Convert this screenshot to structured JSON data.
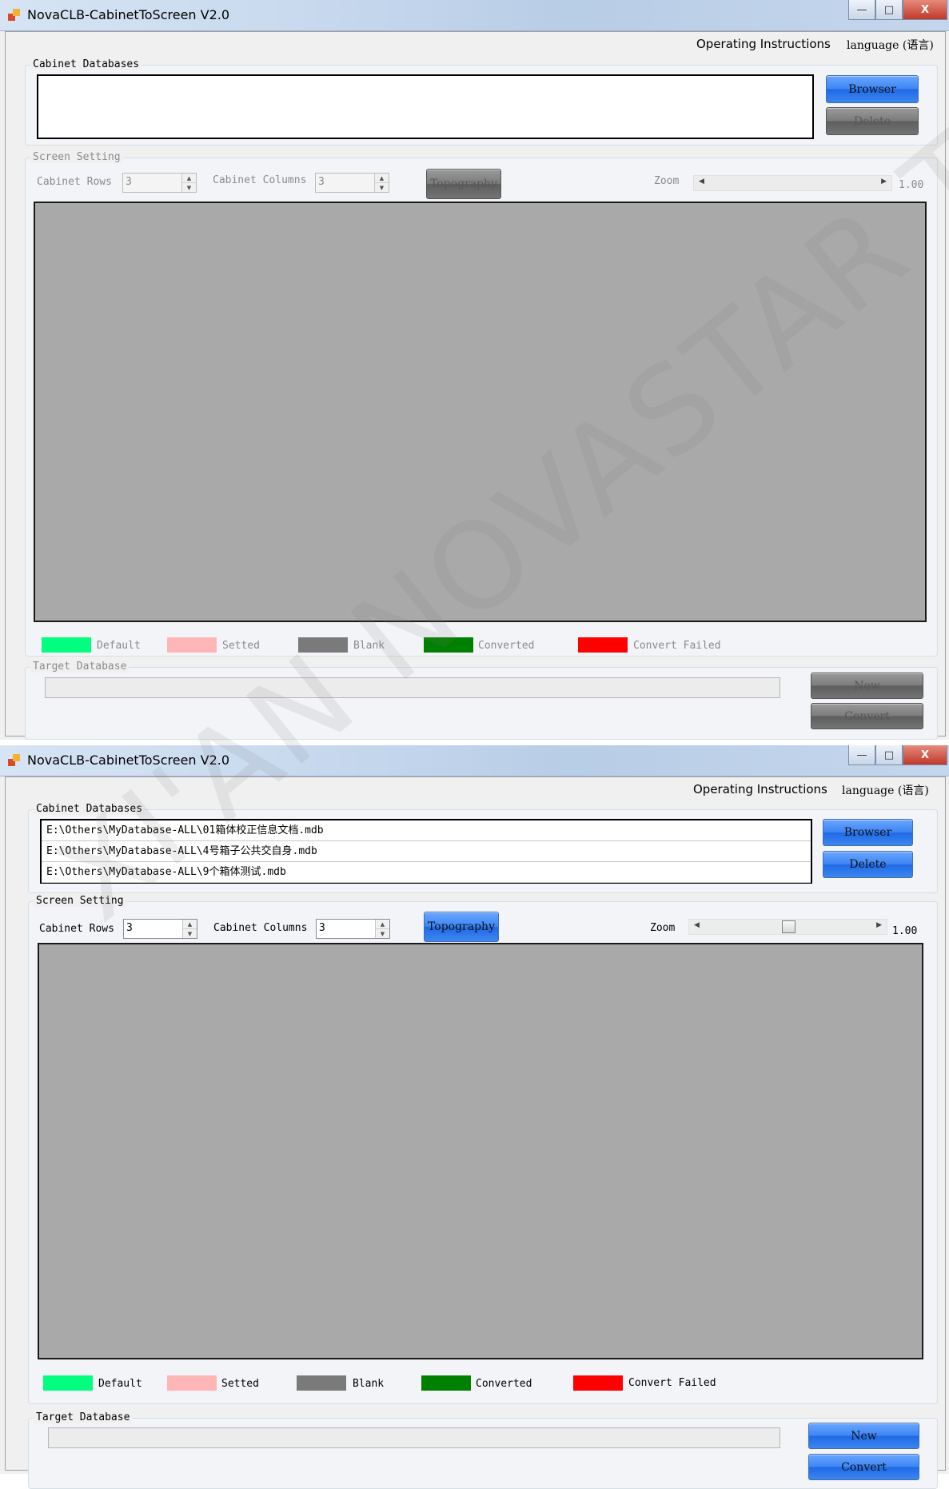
{
  "window_title": "NovaCLB-CabinetToScreen V2.0",
  "menu": {
    "instructions": "Operating Instructions",
    "language": "language (语言)"
  },
  "groups": {
    "cabinet_databases": "Cabinet Databases",
    "screen_setting": "Screen Setting",
    "target_database": "Target Database"
  },
  "buttons": {
    "browser": "Browser",
    "delete": "Delete",
    "topography": "Topography",
    "new": "New",
    "convert": "Convert"
  },
  "labels": {
    "cabinet_rows": "Cabinet Rows",
    "cabinet_columns": "Cabinet Columns",
    "zoom": "Zoom",
    "zoom_value": "1.00"
  },
  "fields": {
    "rows_value": "3",
    "columns_value": "3",
    "target_path": ""
  },
  "legend": [
    {
      "label": "Default",
      "color": "#00ff7f"
    },
    {
      "label": "Setted",
      "color": "#ffb6b6"
    },
    {
      "label": "Blank",
      "color": "#7a7a7a"
    },
    {
      "label": "Converted",
      "color": "#008000"
    },
    {
      "label": "Convert Failed",
      "color": "#ff0000"
    }
  ],
  "database_files": [
    "E:\\Others\\MyDatabase-ALL\\01箱体校正信息文档.mdb",
    "E:\\Others\\MyDatabase-ALL\\4号箱子公共交自身.mdb",
    "E:\\Others\\MyDatabase-ALL\\9个箱体测试.mdb"
  ],
  "window_controls": {
    "minimize": "—",
    "maximize": "□",
    "close": "X"
  },
  "watermark": "XI'AN NOVASTAR TECH CO.,LTD"
}
